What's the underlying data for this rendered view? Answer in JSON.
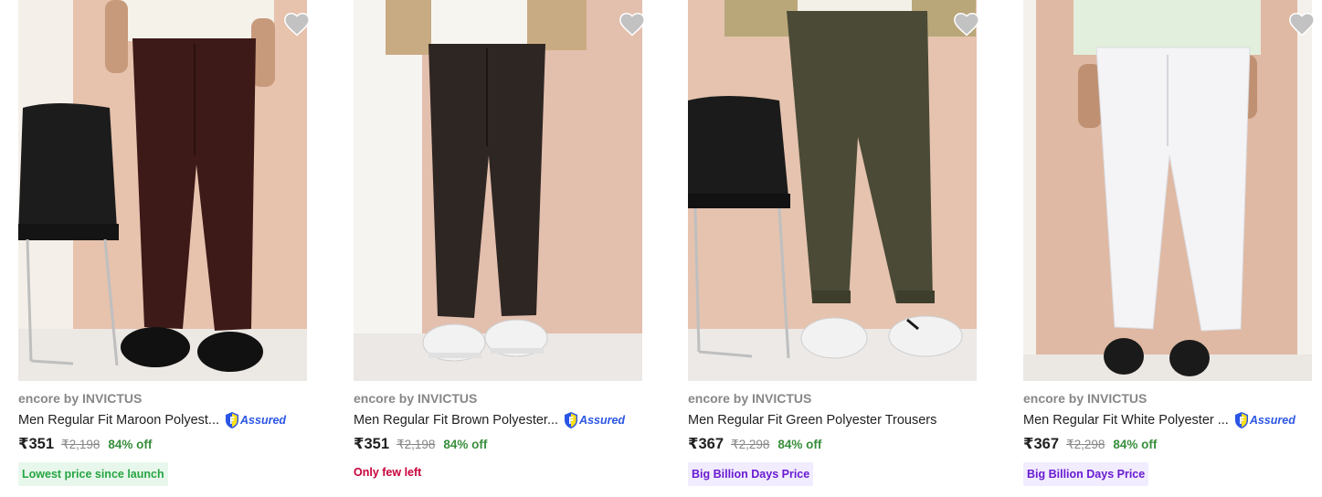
{
  "products": [
    {
      "brand": "encore by INVICTUS",
      "title": "Men Regular Fit Maroon Polyest...",
      "assured": true,
      "assured_label": "Assured",
      "price": "₹351",
      "mrp": "₹2,198",
      "discount": "84% off",
      "tag": "Lowest price since launch",
      "tag_style": "green",
      "pant_color": "#3d1a18",
      "bg_color": "#e7c2ad",
      "shoe_color": "#111111"
    },
    {
      "brand": "encore by INVICTUS",
      "title": "Men Regular Fit Brown Polyester...",
      "assured": true,
      "assured_label": "Assured",
      "price": "₹351",
      "mrp": "₹2,198",
      "discount": "84% off",
      "tag": "Only few left",
      "tag_style": "plain",
      "pant_color": "#2e2622",
      "bg_color": "#e3bfae",
      "shoe_color": "#f2f2f2"
    },
    {
      "brand": "encore by INVICTUS",
      "title": "Men Regular Fit Green Polyester Trousers",
      "assured": false,
      "assured_label": "",
      "price": "₹367",
      "mrp": "₹2,298",
      "discount": "84% off",
      "tag": "Big Billion Days Price",
      "tag_style": "purple",
      "pant_color": "#4a4a36",
      "bg_color": "#e5c3af",
      "shoe_color": "#f2f2f2"
    },
    {
      "brand": "encore by INVICTUS",
      "title": "Men Regular Fit White Polyester ...",
      "assured": true,
      "assured_label": "Assured",
      "price": "₹367",
      "mrp": "₹2,298",
      "discount": "84% off",
      "tag": "Big Billion Days Price",
      "tag_style": "purple",
      "pant_color": "#f4f4f6",
      "bg_color": "#dfb9a3",
      "shoe_color": "#1a1a1a"
    }
  ],
  "icons": {
    "wishlist": "heart-icon",
    "assured": "assured-shield-icon"
  }
}
